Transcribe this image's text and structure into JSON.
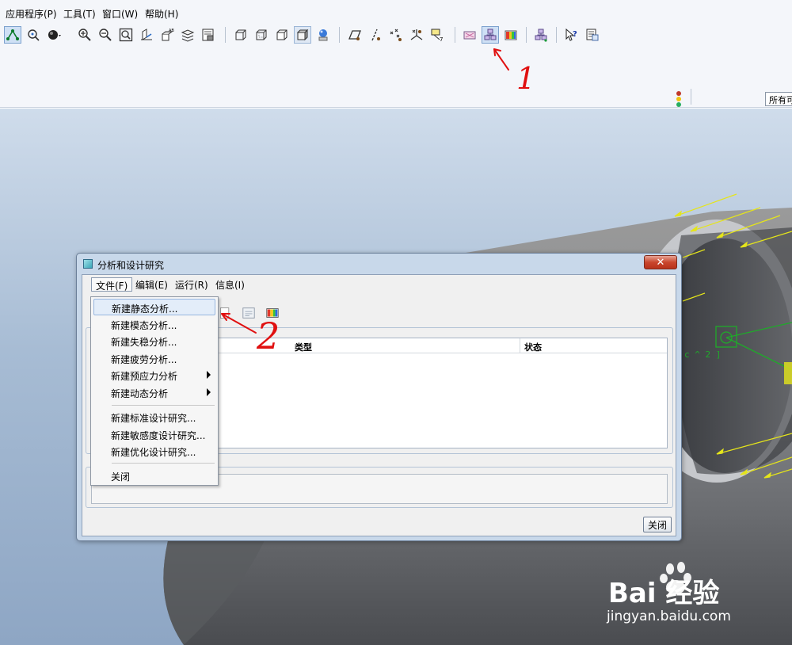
{
  "menubar": {
    "items": [
      "应用程序(P)",
      "工具(T)",
      "窗口(W)",
      "帮助(H)"
    ]
  },
  "toolbar": {
    "icons": [
      "select-icon",
      "spin-icon",
      "sphere-icon",
      "zoom-in-icon",
      "zoom-out-icon",
      "refit-icon",
      "reorient-icon",
      "named-view-icon",
      "layer-icon",
      "view-manager-icon",
      "wireframe-icon",
      "hidden-line-icon",
      "no-hidden-icon",
      "shading-icon",
      "appearance-icon",
      "datum-plane-icon",
      "datum-axis-icon",
      "datum-point-icon",
      "csys-icon",
      "annotation-icon",
      "analysis-icon",
      "design-study-icon",
      "results-icon",
      "model-tree-icon",
      "whats-this-icon",
      "info-icon"
    ]
  },
  "ribbon": {
    "filter_label": "所有可"
  },
  "dialog": {
    "title": "分析和设计研究",
    "close_glyph": "✕",
    "menus": [
      "文件(F)",
      "编辑(E)",
      "运行(R)",
      "信息(I)"
    ],
    "table_headers": [
      "类型",
      "状态"
    ],
    "close_button": "关闭"
  },
  "file_menu": {
    "items": [
      "新建静态分析...",
      "新建模态分析...",
      "新建失稳分析...",
      "新建疲劳分析...",
      "新建预应力分析",
      "新建动态分析",
      "新建标准设计研究...",
      "新建敏感度设计研究...",
      "新建优化设计研究...",
      "关闭"
    ]
  },
  "viewport": {
    "model_label": "c ^ 2 ]"
  },
  "annotations": {
    "mark_1": "1",
    "mark_2": "2"
  },
  "watermark": {
    "brand_text": "Bai 经验",
    "url": "jingyan.baidu.com"
  },
  "colors": {
    "accent_red": "#e01010",
    "load_arrow": "#e5e51a",
    "viewport_top": "#cfdceb",
    "viewport_bottom": "#8ea6c4"
  }
}
